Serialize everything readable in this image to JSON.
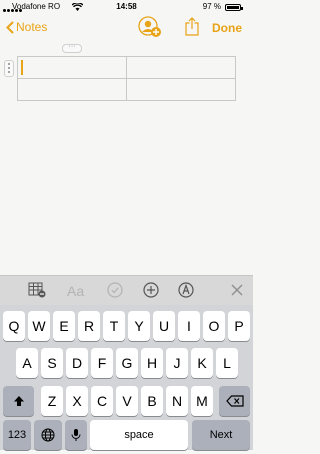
{
  "status_bar": {
    "carrier": "Vodafone RO",
    "time": "14:58",
    "battery": "97 %",
    "battery_level": 0.97
  },
  "nav": {
    "back_label": "Notes",
    "done_label": "Done"
  },
  "table_handle": "···",
  "note_table": [
    [
      "",
      ""
    ],
    [
      "",
      ""
    ]
  ],
  "toolbar": {
    "format_label": "Aa"
  },
  "keyboard": {
    "row1": [
      "Q",
      "W",
      "E",
      "R",
      "T",
      "Y",
      "U",
      "I",
      "O",
      "P"
    ],
    "row2": [
      "A",
      "S",
      "D",
      "F",
      "G",
      "H",
      "J",
      "K",
      "L"
    ],
    "row3": [
      "Z",
      "X",
      "C",
      "V",
      "B",
      "N",
      "M"
    ],
    "numbers_label": "123",
    "space_label": "space",
    "next_label": "Next"
  },
  "colors": {
    "accent": "#e8a317",
    "keyboard_bg": "#d2d4d8",
    "function_key": "#abb0ba"
  }
}
